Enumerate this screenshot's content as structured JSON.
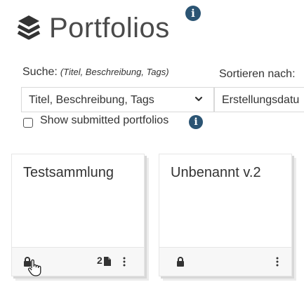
{
  "header": {
    "title": "Portfolios",
    "info_badge": "i",
    "icon": "layers-icon"
  },
  "search": {
    "label": "Suche:",
    "hint": "(Titel, Beschreibung, Tags)",
    "selected": "Titel, Beschreibung, Tags"
  },
  "sort": {
    "label": "Sortieren nach:",
    "selected": "Erstellungsdatu"
  },
  "filter": {
    "show_submitted_label": "Show submitted portfolios",
    "checked": false,
    "info_badge": "i"
  },
  "portfolios": [
    {
      "title": "Testsammlung",
      "page_count": "2",
      "locked": true
    },
    {
      "title": "Unbenannt v.2",
      "page_count": "",
      "locked": true
    }
  ],
  "colors": {
    "accent": "#2b5473",
    "text": "#333333",
    "border": "#d9d9d9",
    "footer_bg": "#f7f7f7"
  }
}
